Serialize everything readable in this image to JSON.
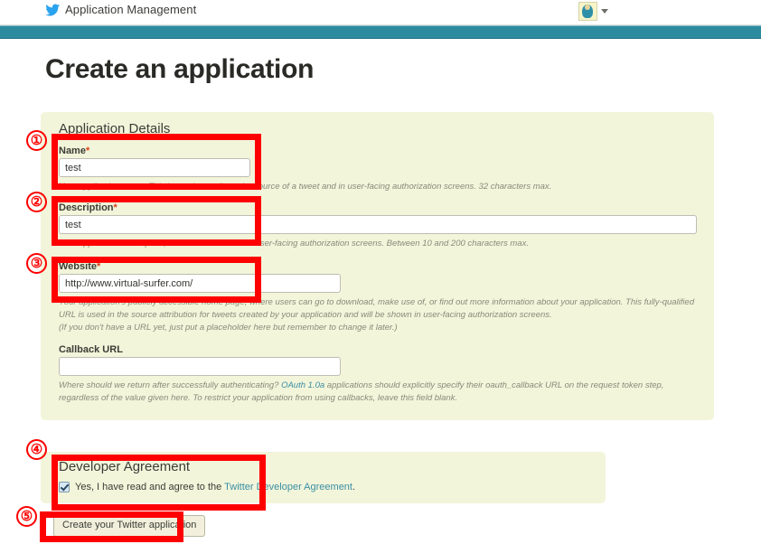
{
  "topbar": {
    "brand_icon": "twitter-bird-icon",
    "brand_text": "Application Management",
    "avatar_icon": "user-avatar",
    "caret_icon": "chevron-down-icon"
  },
  "page": {
    "title": "Create an application"
  },
  "details_section": {
    "title": "Application Details",
    "fields": [
      {
        "label": "Name",
        "required_mark": "*",
        "value": "test",
        "placeholder": "",
        "help": "Your application name. This is used to attribute the source of a tweet and in user-facing authorization screens. 32 characters max."
      },
      {
        "label": "Description",
        "required_mark": "*",
        "value": "test",
        "placeholder": "",
        "help": "Your application description, which will be shown in user-facing authorization screens. Between 10 and 200 characters max."
      },
      {
        "label": "Website",
        "required_mark": "*",
        "value": "http://www.virtual-surfer.com/",
        "placeholder": "",
        "help_line1": "Your application's publicly accessible home page, where users can go to download, make use of, or find out more information about your application. This fully-qualified URL is used in the source",
        "help_line2": "attribution for tweets created by your application and will be shown in user-facing authorization screens.",
        "help_line3": "(If you don't have a URL yet, just put a placeholder here but remember to change it later.)"
      },
      {
        "label": "Callback URL",
        "required_mark": "",
        "value": "",
        "placeholder": "",
        "help_pre": "Where should we return after successfully authenticating? ",
        "help_link": "OAuth 1.0a",
        "help_post": " applications should explicitly specify their oauth_callback URL on the request token step, regardless of the value given here. To restrict your application from using callbacks, leave this field blank."
      }
    ]
  },
  "agreement_section": {
    "title": "Developer Agreement",
    "checkbox_checked": "true",
    "text_pre": "Yes, I have read and agree to the ",
    "link_text": "Twitter Developer Agreement",
    "text_post": "."
  },
  "submit": {
    "label": "Create your Twitter application"
  },
  "annotations": {
    "numbers": [
      "①",
      "②",
      "③",
      "④",
      "⑤"
    ],
    "color": "#fe0000"
  },
  "colors": {
    "panel_bg": "#f2f5da",
    "teal_band": "#2d8ba0",
    "link": "#3b8ea5",
    "required": "#d9431f",
    "annotation": "#fe0000"
  }
}
